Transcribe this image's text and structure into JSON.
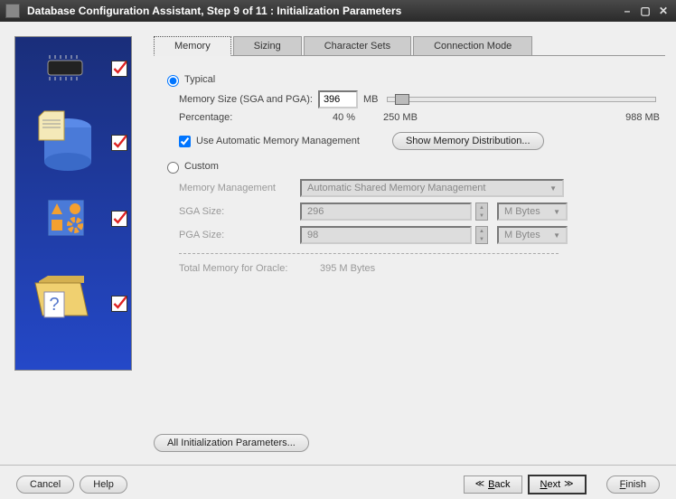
{
  "window": {
    "title": "Database Configuration Assistant, Step 9 of 11 : Initialization Parameters"
  },
  "tabs": {
    "memory": "Memory",
    "sizing": "Sizing",
    "charsets": "Character Sets",
    "connection": "Connection Mode"
  },
  "memory": {
    "typical_label": "Typical",
    "memsize_label": "Memory Size (SGA and PGA):",
    "memsize_value": "396",
    "memsize_unit": "MB",
    "percentage_label": "Percentage:",
    "percentage_value": "40 %",
    "slider_min": "250 MB",
    "slider_max": "988 MB",
    "auto_mem_label": "Use Automatic Memory Management",
    "show_dist_btn": "Show Memory Distribution...",
    "custom_label": "Custom",
    "mm_label": "Memory Management",
    "mm_value": "Automatic Shared Memory Management",
    "sga_label": "SGA Size:",
    "sga_value": "296",
    "pga_label": "PGA Size:",
    "pga_value": "98",
    "unit_select": "M Bytes",
    "total_label": "Total Memory for Oracle:",
    "total_value": "395 M Bytes",
    "all_params_btn": "All Initialization Parameters..."
  },
  "footer": {
    "cancel": "Cancel",
    "help": "Help",
    "back": "Back",
    "back_mnemonic": "B",
    "next": "Next",
    "next_mnemonic": "N",
    "finish": "Finish",
    "finish_mnemonic": "F"
  }
}
